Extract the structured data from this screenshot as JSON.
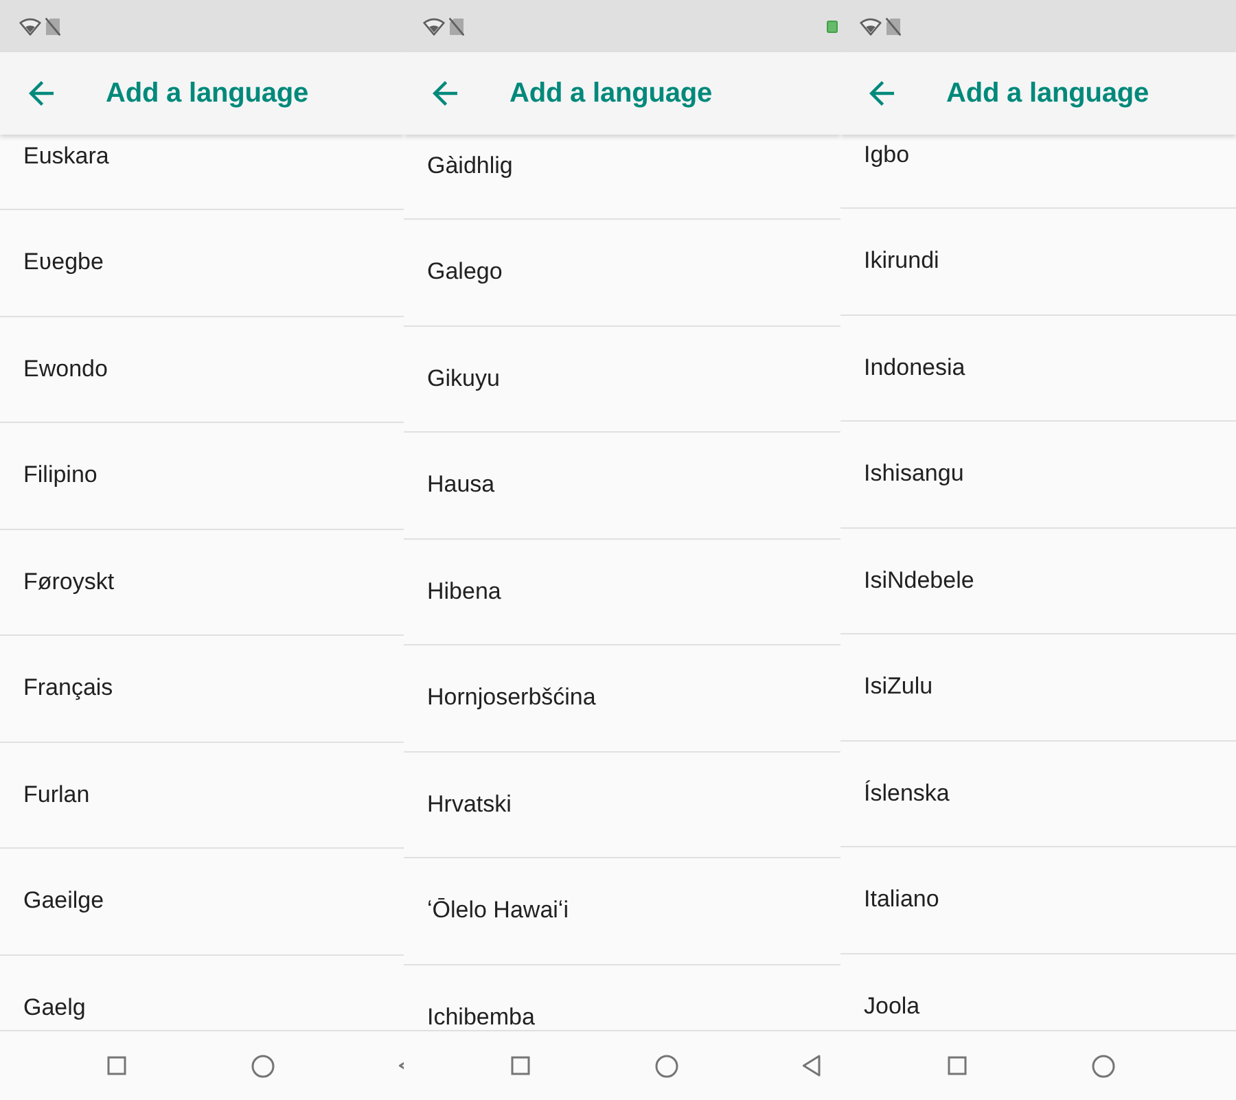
{
  "panels": [
    {
      "status_bar": {
        "icons": [
          {
            "kind": "wifi"
          },
          {
            "kind": "no_sim"
          }
        ]
      },
      "toolbar": {
        "title": "Add a language"
      },
      "languages": [
        "Euskara",
        "Eʋegbe",
        "Ewondo",
        "Filipino",
        "Føroyskt",
        "Français",
        "Furlan",
        "Gaeilge",
        "Gaelg"
      ],
      "nav_bar": {
        "buttons": [
          {
            "kind": "recents"
          },
          {
            "kind": "home"
          },
          {
            "kind": "back"
          }
        ]
      }
    },
    {
      "status_bar": {
        "icons": [
          {
            "kind": "wifi"
          },
          {
            "kind": "no_sim"
          }
        ],
        "end_icons": [
          {
            "kind": "battery"
          }
        ]
      },
      "toolbar": {
        "title": "Add a language"
      },
      "languages": [
        "Gàidhlig",
        "Galego",
        "Gikuyu",
        "Hausa",
        "Hibena",
        "Hornjoserbšćina",
        "Hrvatski",
        "ʻŌlelo Hawaiʻi",
        "Ichibemba"
      ],
      "nav_bar": {
        "buttons": [
          {
            "kind": "recents"
          },
          {
            "kind": "home"
          },
          {
            "kind": "back"
          }
        ]
      }
    },
    {
      "status_bar": {
        "icons": [
          {
            "kind": "wifi"
          },
          {
            "kind": "no_sim"
          }
        ]
      },
      "toolbar": {
        "title": "Add a language"
      },
      "languages": [
        "Igbo",
        "Ikirundi",
        "Indonesia",
        "Ishisangu",
        "IsiNdebele",
        "IsiZulu",
        "Íslenska",
        "Italiano",
        "Joola"
      ],
      "nav_bar": {
        "buttons": [
          {
            "kind": "recents"
          },
          {
            "kind": "home"
          }
        ]
      }
    }
  ]
}
